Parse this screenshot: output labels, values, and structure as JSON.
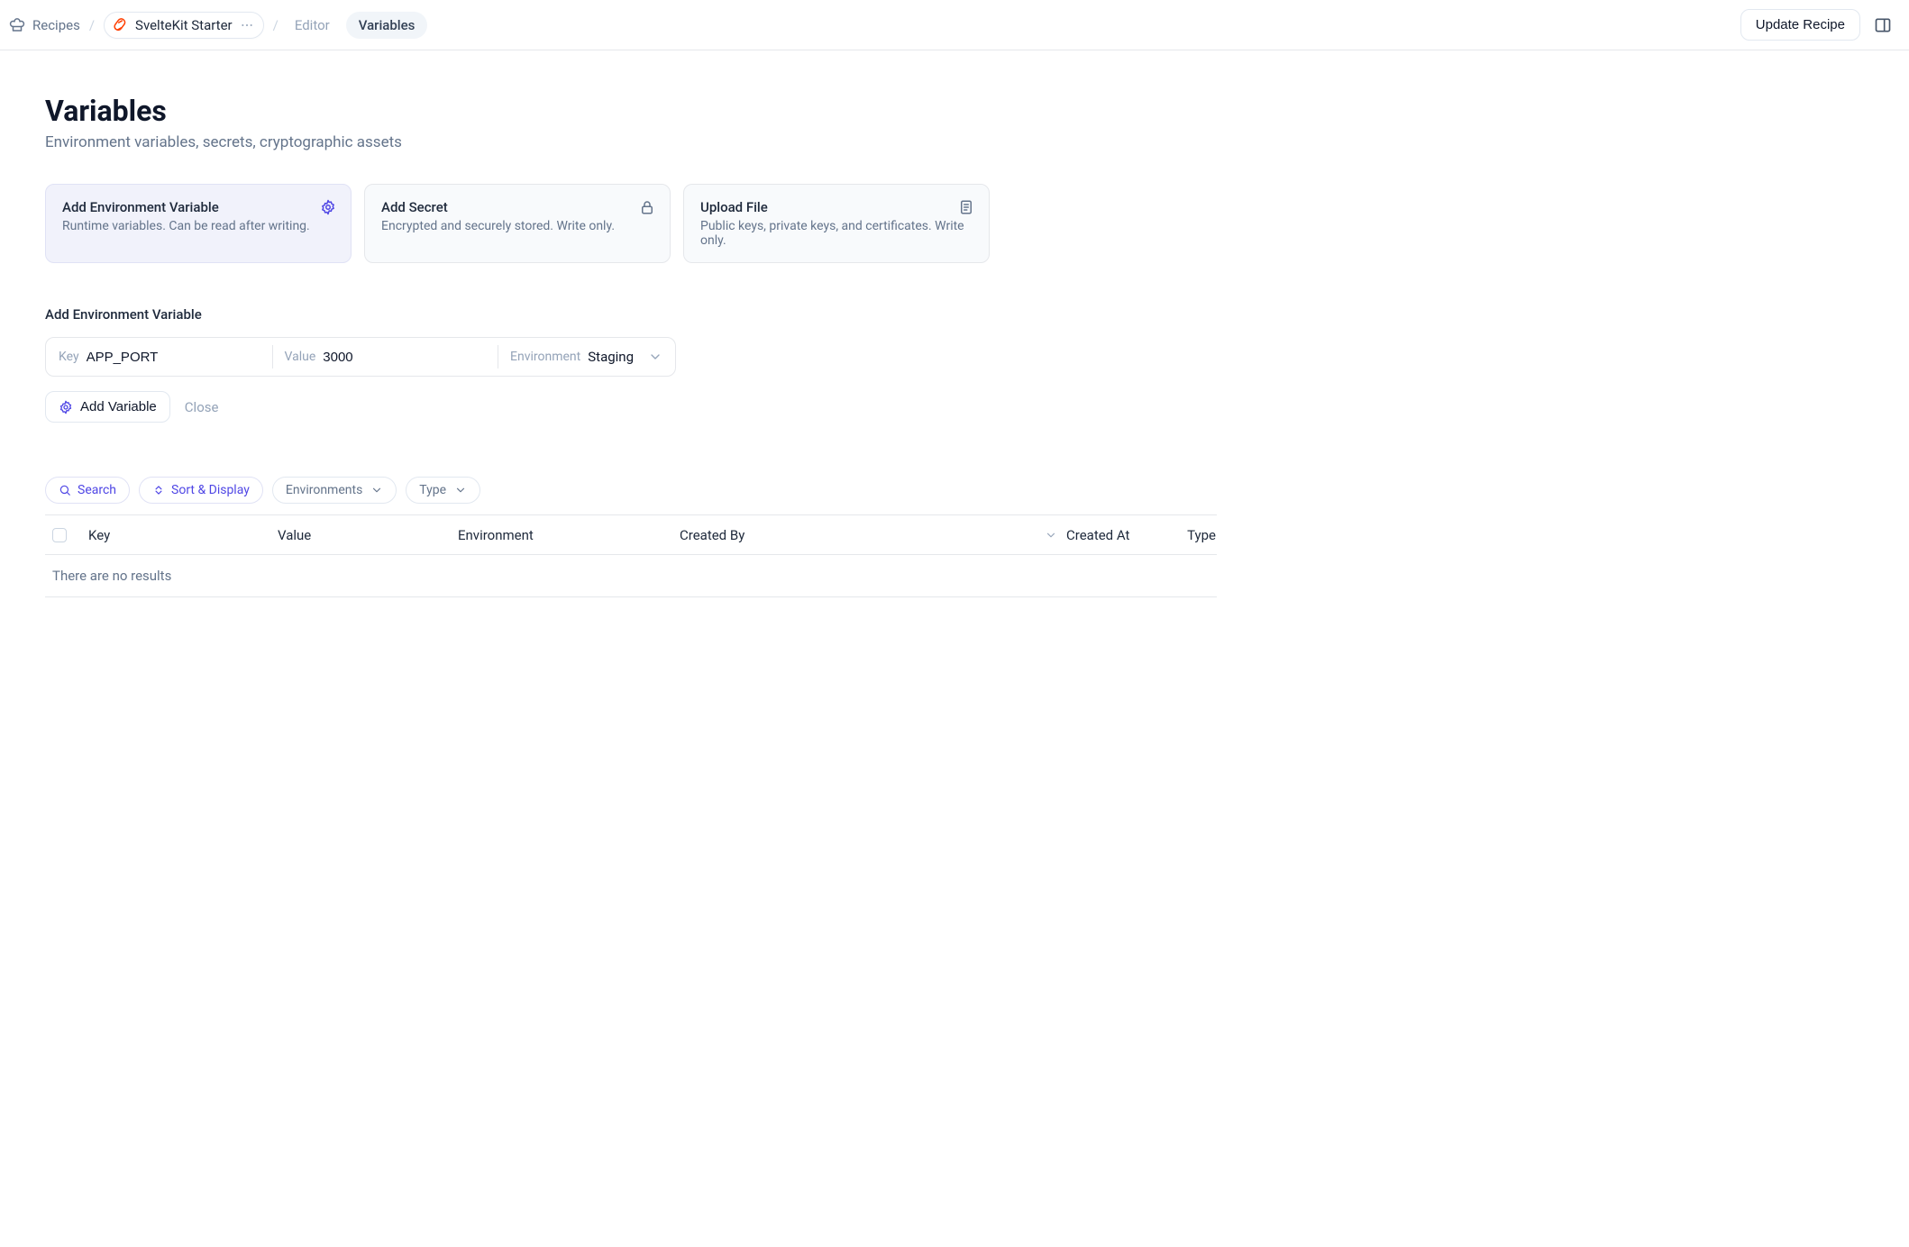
{
  "breadcrumb": {
    "root_label": "Recipes",
    "recipe_name": "SvelteKit Starter",
    "editor_label": "Editor",
    "variables_label": "Variables"
  },
  "header_actions": {
    "update_label": "Update Recipe"
  },
  "page": {
    "title": "Variables",
    "subtitle": "Environment variables, secrets, cryptographic assets"
  },
  "cards": {
    "env": {
      "title": "Add Environment Variable",
      "desc": "Runtime variables. Can be read after writing."
    },
    "secret": {
      "title": "Add Secret",
      "desc": "Encrypted and securely stored. Write only."
    },
    "file": {
      "title": "Upload File",
      "desc": "Public keys, private keys, and certificates. Write only."
    }
  },
  "form": {
    "title": "Add Environment Variable",
    "key_label": "Key",
    "key_value": "APP_PORT",
    "value_label": "Value",
    "value_value": "3000",
    "env_label": "Environment",
    "env_value": "Staging",
    "add_button": "Add Variable",
    "close_button": "Close"
  },
  "filters": {
    "search": "Search",
    "sort": "Sort & Display",
    "environments": "Environments",
    "type": "Type"
  },
  "table": {
    "cols": {
      "key": "Key",
      "value": "Value",
      "environment": "Environment",
      "created_by": "Created By",
      "created_at": "Created At",
      "type": "Type"
    },
    "empty": "There are no results"
  }
}
